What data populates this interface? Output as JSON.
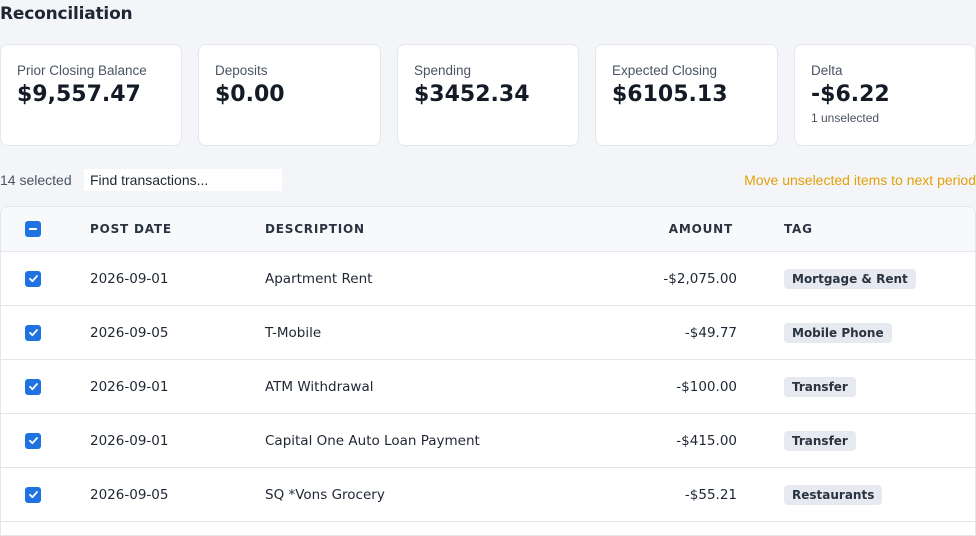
{
  "page": {
    "title": "Reconciliation"
  },
  "cards": [
    {
      "label": "Prior Closing Balance",
      "value": "$9,557.47",
      "sub": ""
    },
    {
      "label": "Deposits",
      "value": "$0.00",
      "sub": ""
    },
    {
      "label": "Spending",
      "value": "$3452.34",
      "sub": ""
    },
    {
      "label": "Expected Closing",
      "value": "$6105.13",
      "sub": ""
    },
    {
      "label": "Delta",
      "value": "-$6.22",
      "sub": "1 unselected"
    }
  ],
  "toolbar": {
    "selected_count": "14 selected",
    "search_placeholder": "Find transactions...",
    "move_unselected_label": "Move unselected items to next period"
  },
  "table": {
    "headers": {
      "date": "POST DATE",
      "description": "DESCRIPTION",
      "amount": "AMOUNT",
      "tag": "TAG"
    },
    "rows": [
      {
        "date": "2026-09-01",
        "description": "Apartment Rent",
        "amount": "-$2,075.00",
        "tag": "Mortgage & Rent"
      },
      {
        "date": "2026-09-05",
        "description": "T-Mobile",
        "amount": "-$49.77",
        "tag": "Mobile Phone"
      },
      {
        "date": "2026-09-01",
        "description": "ATM Withdrawal",
        "amount": "-$100.00",
        "tag": "Transfer"
      },
      {
        "date": "2026-09-01",
        "description": "Capital One Auto Loan Payment",
        "amount": "-$415.00",
        "tag": "Transfer"
      },
      {
        "date": "2026-09-05",
        "description": "SQ *Vons Grocery",
        "amount": "-$55.21",
        "tag": "Restaurants"
      }
    ]
  },
  "colors": {
    "accent": "#1f73e0",
    "link": "#e3a008"
  }
}
